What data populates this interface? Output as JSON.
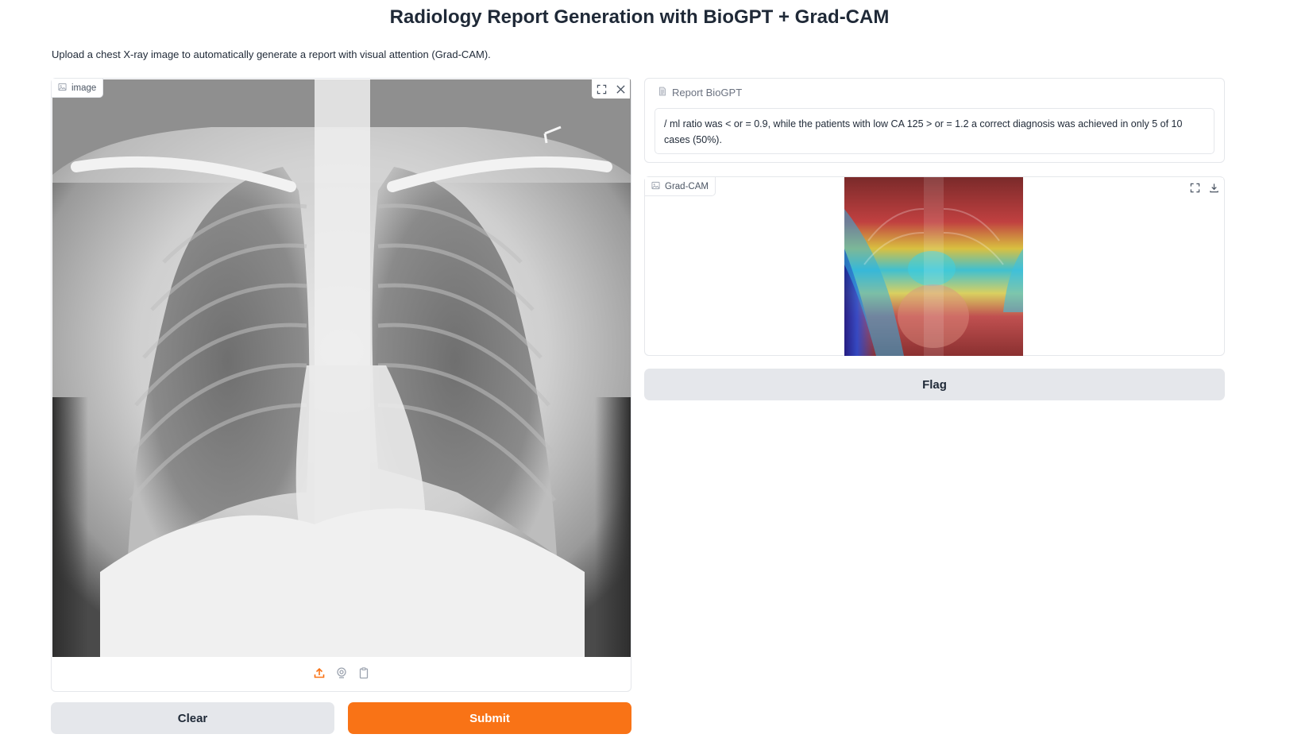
{
  "header": {
    "title": "Radiology Report Generation with BioGPT + Grad-CAM",
    "description": "Upload a chest X-ray image to automatically generate a report with visual attention (Grad-CAM)."
  },
  "input": {
    "label": "image",
    "icons": [
      "image-icon",
      "fullscreen-icon",
      "close-icon",
      "upload-icon",
      "webcam-icon",
      "clipboard-icon"
    ]
  },
  "report": {
    "label": "Report BioGPT",
    "text": "/ ml ratio was < or = 0.9, while the patients with low CA 125 > or = 1.2 a correct diagnosis was achieved in only 5 of 10 cases (50%)."
  },
  "gradcam": {
    "label": "Grad-CAM",
    "icons": [
      "image-icon",
      "fullscreen-icon",
      "download-icon"
    ]
  },
  "buttons": {
    "clear": "Clear",
    "submit": "Submit",
    "flag": "Flag"
  },
  "colors": {
    "accent": "#f97316",
    "secondary_button": "#e5e7eb",
    "border": "#e5e7eb"
  }
}
